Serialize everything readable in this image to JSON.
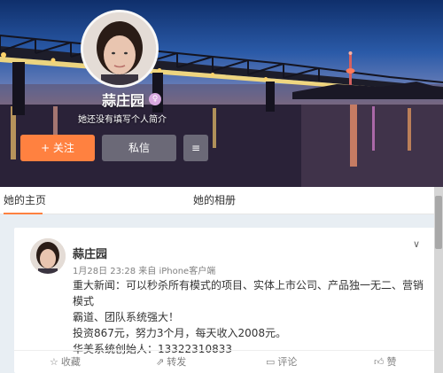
{
  "profile": {
    "name": "蒜庄园",
    "bio": "她还没有填写个人简介",
    "verify_icon": "verified-badge-icon"
  },
  "buttons": {
    "follow_label": "+ 关注",
    "message_label": "私信",
    "more_icon": "menu-icon"
  },
  "tabs": {
    "home_label": "她的主页",
    "album_label": "她的相册"
  },
  "post": {
    "author": "蒜庄园",
    "meta": "1月28日 23:28 来自 iPhone客户端",
    "lines": [
      "重大新闻：可以秒杀所有模式的项目、实体上市公司、产品独一无二、营销模式",
      "霸道、团队系统强大！",
      "投资867元，努力3个月，每天收入2008元。",
      "华美系统创始人：13322310833"
    ],
    "actions": {
      "favorite": "收藏",
      "forward": "转发",
      "comment": "评论",
      "like": "赞"
    }
  },
  "colors": {
    "accent": "#ff8140"
  }
}
